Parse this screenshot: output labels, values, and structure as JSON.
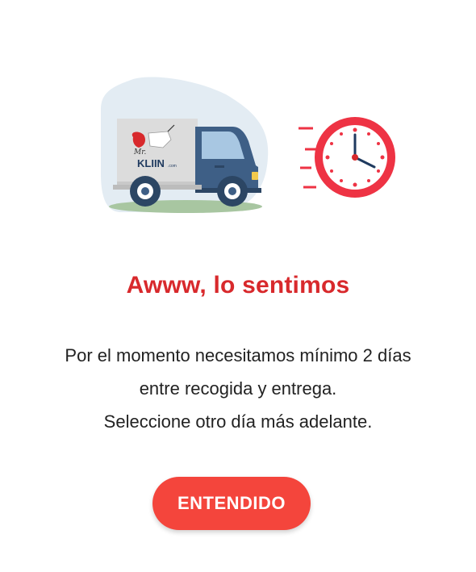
{
  "illustration": {
    "truck_logo_script": "Mr.",
    "truck_logo_brand": "KLIIN",
    "truck_logo_suffix": ".com",
    "clock_color": "#ee3344",
    "truck_cab_color": "#3e5f86"
  },
  "dialog": {
    "title": "Awww, lo sentimos",
    "message_lines": [
      "Por el momento necesitamos mínimo 2 días",
      "entre recogida y entrega.",
      "Seleccione otro día más adelante."
    ],
    "confirm_label": "ENTENDIDO"
  },
  "colors": {
    "title": "#d8292c",
    "button": "#f4453c",
    "text": "#222222"
  }
}
